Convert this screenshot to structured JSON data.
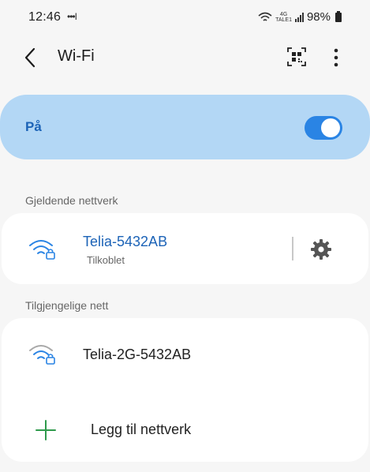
{
  "status_bar": {
    "time": "12:46",
    "dots": "•••I",
    "network_type_top": "4G",
    "network_type_bottom": "TALE1",
    "battery": "98%"
  },
  "header": {
    "title": "Wi-Fi"
  },
  "toggle": {
    "label": "På",
    "state": "on",
    "accent": "#2a84e4"
  },
  "current": {
    "header": "Gjeldende nettverk",
    "network": {
      "name": "Telia-5432AB",
      "status": "Tilkoblet",
      "color": "#1c63b7"
    }
  },
  "available": {
    "header": "Tilgjengelige nett",
    "networks": [
      {
        "name": "Telia-2G-5432AB"
      }
    ],
    "add_label": "Legg til nettverk"
  }
}
